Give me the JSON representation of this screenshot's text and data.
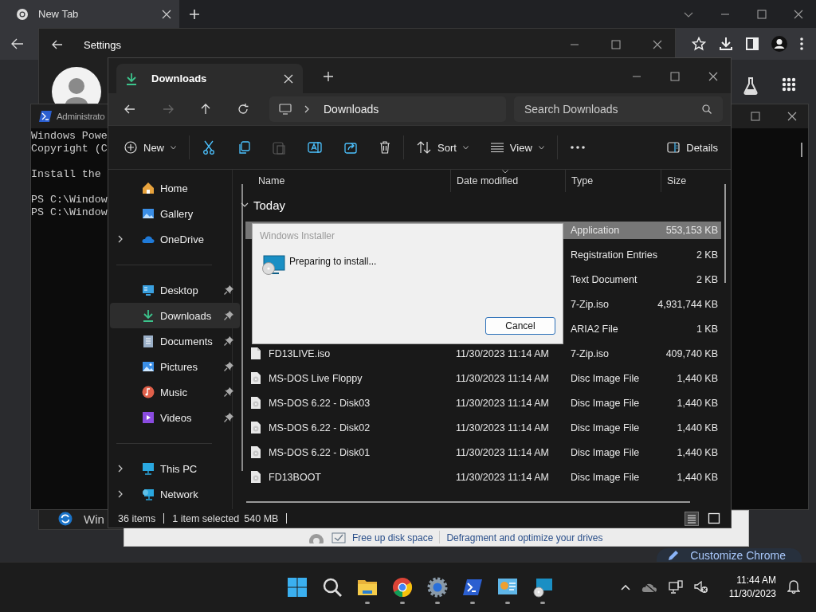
{
  "chrome": {
    "tab_title": "New Tab",
    "customize_label": "Customize Chrome"
  },
  "settings": {
    "title": "Settings",
    "nav_label": "Win"
  },
  "powershell": {
    "title": "Administrato",
    "paragraphs": [
      [
        "Windows Powe",
        "Copyright (C"
      ],
      [
        "Install the"
      ],
      [
        "PS C:\\Window",
        "PS C:\\Window"
      ]
    ]
  },
  "disk_tool": {
    "links": [
      "Free up disk space",
      "Defragment and optimize your drives"
    ]
  },
  "explorer": {
    "tab_title": "Downloads",
    "breadcrumb": "Downloads",
    "search": {
      "placeholder": "Search Downloads"
    },
    "toolbar": {
      "new_label": "New",
      "sort_label": "Sort",
      "view_label": "View",
      "details_label": "Details"
    },
    "nav_sections": [
      [
        {
          "label": "Home",
          "kind": "home",
          "expandable": false,
          "pinned": false,
          "selected": false
        },
        {
          "label": "Gallery",
          "kind": "gallery",
          "expandable": false,
          "pinned": false,
          "selected": false
        },
        {
          "label": "OneDrive",
          "kind": "cloud",
          "expandable": true,
          "pinned": false,
          "selected": false
        }
      ],
      [
        {
          "label": "Desktop",
          "kind": "desktop",
          "expandable": false,
          "pinned": true,
          "selected": false
        },
        {
          "label": "Downloads",
          "kind": "download",
          "expandable": false,
          "pinned": true,
          "selected": true
        },
        {
          "label": "Documents",
          "kind": "documents",
          "expandable": false,
          "pinned": true,
          "selected": false
        },
        {
          "label": "Pictures",
          "kind": "pictures",
          "expandable": false,
          "pinned": true,
          "selected": false
        },
        {
          "label": "Music",
          "kind": "music",
          "expandable": false,
          "pinned": true,
          "selected": false
        },
        {
          "label": "Videos",
          "kind": "videos",
          "expandable": false,
          "pinned": true,
          "selected": false
        }
      ],
      [
        {
          "label": "This PC",
          "kind": "pc",
          "expandable": true,
          "pinned": false,
          "selected": false
        },
        {
          "label": "Network",
          "kind": "network",
          "expandable": true,
          "pinned": false,
          "selected": false
        }
      ]
    ],
    "columns": [
      "Name",
      "Date modified",
      "Type",
      "Size"
    ],
    "group": "Today",
    "rows": [
      {
        "type": "Application",
        "size": "553,153 KB",
        "selected": true
      },
      {
        "type": "Registration Entries",
        "size": "2 KB",
        "selected": false
      },
      {
        "type": "Text Document",
        "size": "2 KB",
        "selected": false
      },
      {
        "type": "7-Zip.iso",
        "size": "4,931,744 KB",
        "selected": false
      },
      {
        "type": "ARIA2 File",
        "size": "1 KB",
        "selected": false
      },
      {
        "kind": "document",
        "name": "FD13LIVE.iso",
        "date": "11/30/2023 11:14 AM",
        "type": "7-Zip.iso",
        "size": "409,740 KB",
        "selected": false
      },
      {
        "kind": "disc",
        "name": "MS-DOS Live Floppy",
        "date": "11/30/2023 11:14 AM",
        "type": "Disc Image File",
        "size": "1,440 KB",
        "selected": false
      },
      {
        "kind": "disc",
        "name": "MS-DOS 6.22 - Disk03",
        "date": "11/30/2023 11:14 AM",
        "type": "Disc Image File",
        "size": "1,440 KB",
        "selected": false
      },
      {
        "kind": "disc",
        "name": "MS-DOS 6.22 - Disk02",
        "date": "11/30/2023 11:14 AM",
        "type": "Disc Image File",
        "size": "1,440 KB",
        "selected": false
      },
      {
        "kind": "disc",
        "name": "MS-DOS 6.22 - Disk01",
        "date": "11/30/2023 11:14 AM",
        "type": "Disc Image File",
        "size": "1,440 KB",
        "selected": false
      },
      {
        "kind": "disc",
        "name": "FD13BOOT",
        "date": "11/30/2023 11:14 AM",
        "type": "Disc Image File",
        "size": "1,440 KB",
        "selected": false
      }
    ],
    "status": {
      "count": "36 items",
      "selection": "1 item selected",
      "size": "540 MB"
    }
  },
  "installer": {
    "title": "Windows Installer",
    "message": "Preparing to install...",
    "button": "Cancel"
  },
  "taskbar": {
    "time": "11:44 AM",
    "date": "11/30/2023"
  }
}
